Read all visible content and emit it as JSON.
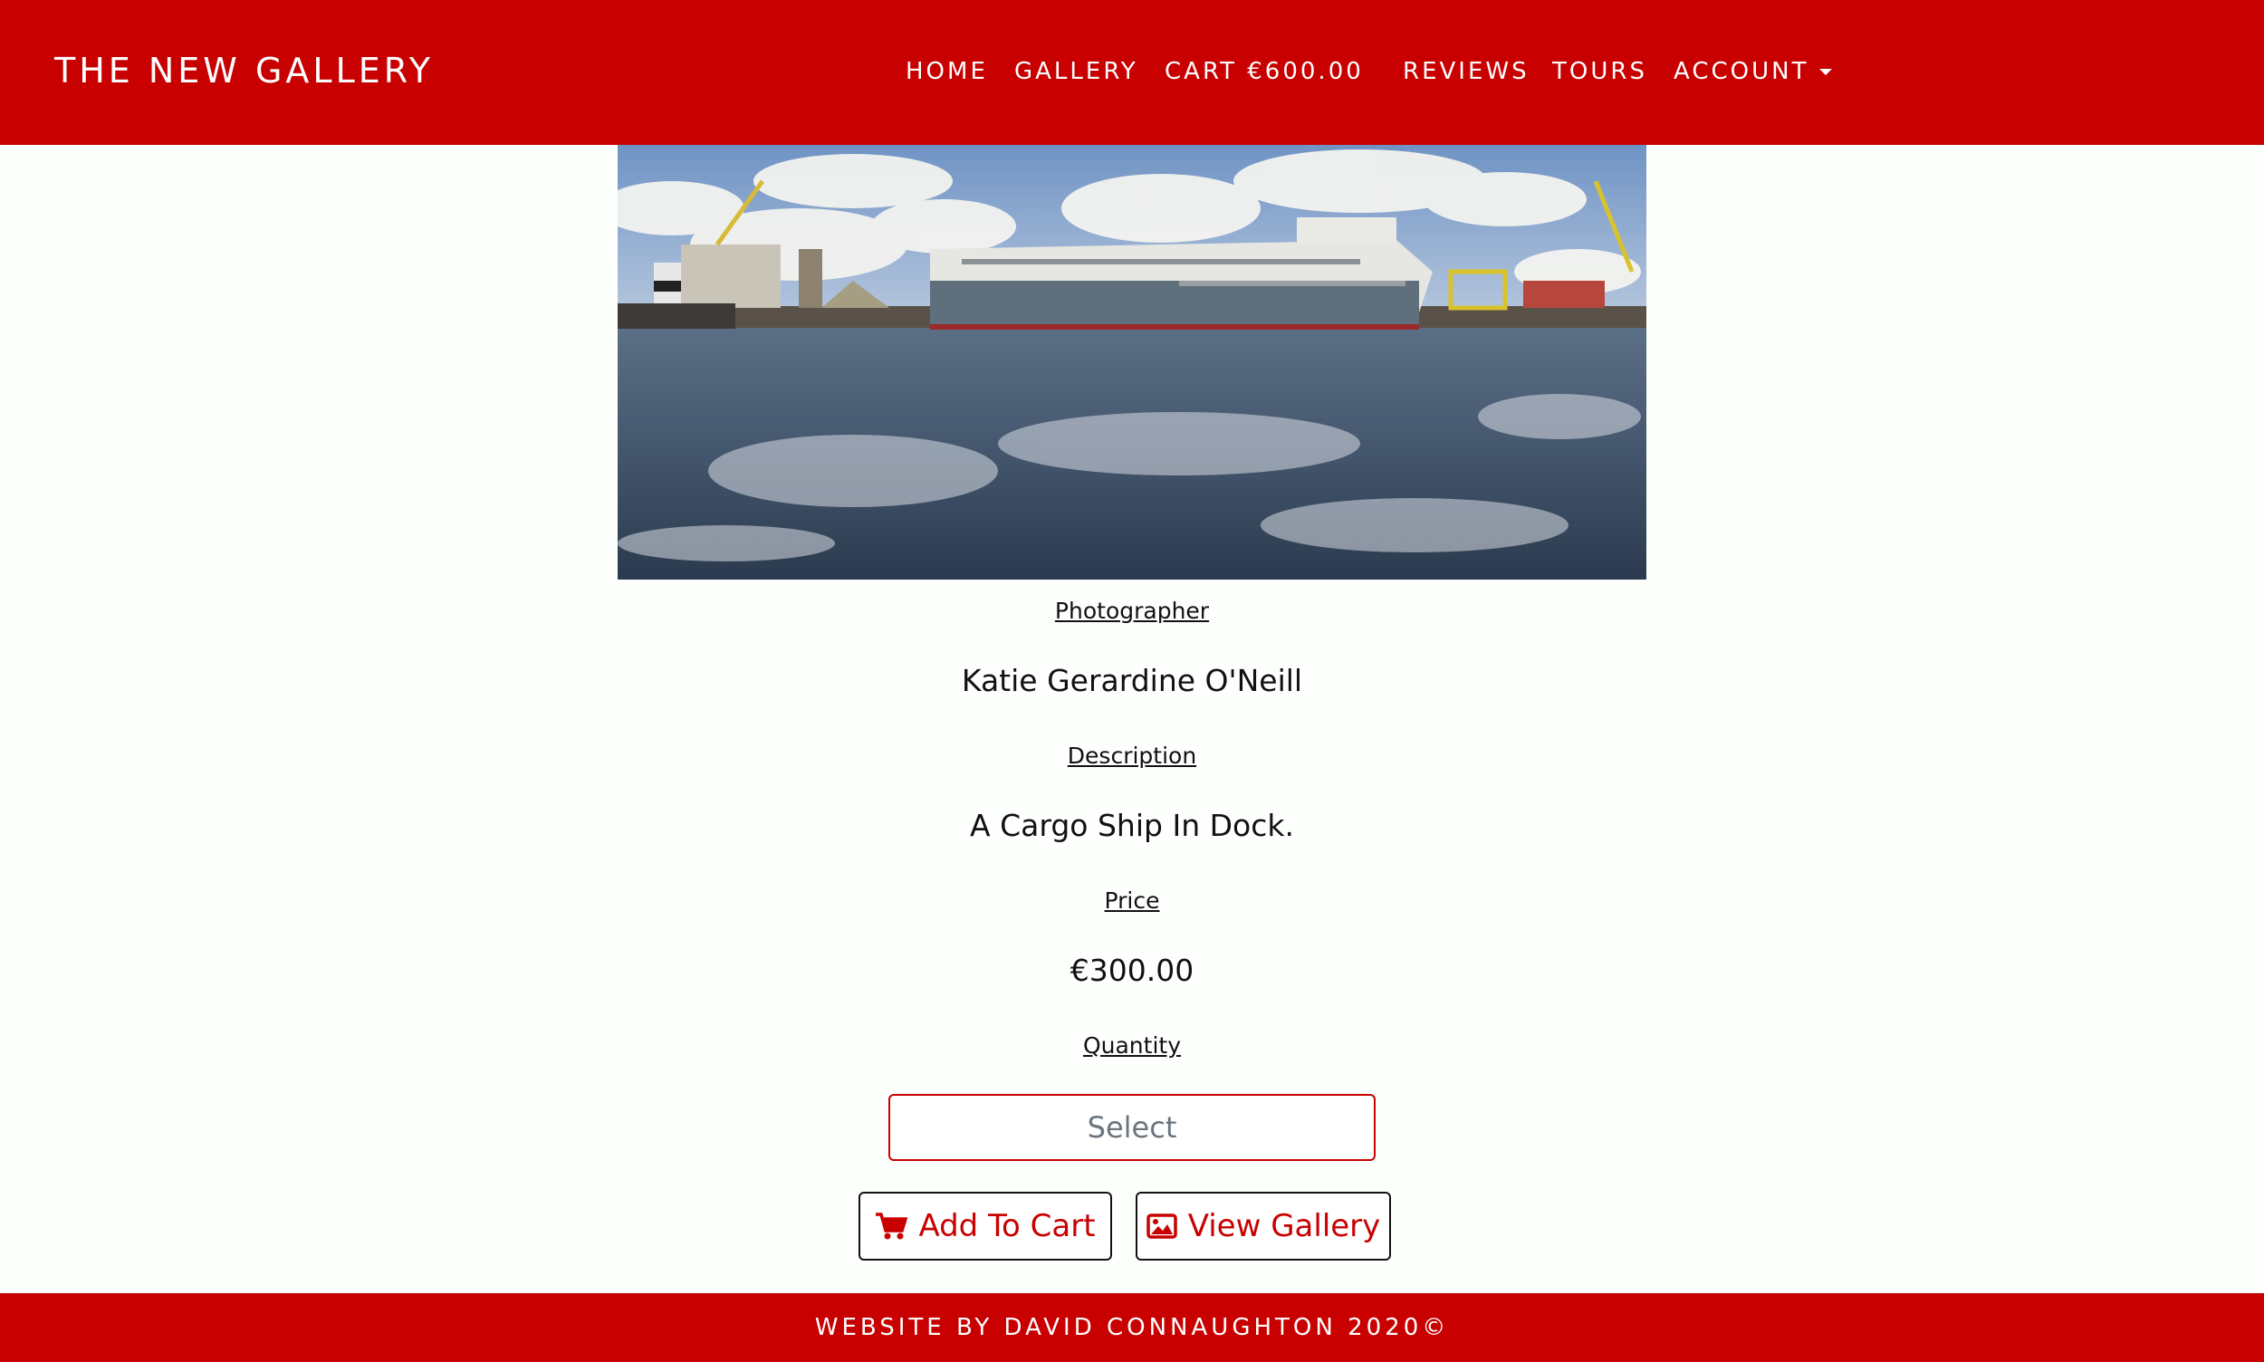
{
  "brand": "THE NEW GALLERY",
  "nav": {
    "home": "HOME",
    "gallery": "GALLERY",
    "cart": "CART €600.00",
    "reviews": "REVIEWS",
    "tours": "TOURS",
    "account": "ACCOUNT"
  },
  "product": {
    "photographer_label": "Photographer",
    "photographer": "Katie Gerardine O'Neill",
    "description_label": "Description",
    "description": "A Cargo Ship In Dock.",
    "price_label": "Price",
    "price": "€300.00",
    "quantity_label": "Quantity",
    "quantity_placeholder": "Select"
  },
  "actions": {
    "add_to_cart": "Add To Cart",
    "view_gallery": "View Gallery"
  },
  "footer": "WEBSITE BY DAVID CONNAUGHTON 2020©",
  "colors": {
    "brand_red": "#c80000",
    "background": "#fcfffc"
  },
  "icons": {
    "cart": "cart-icon",
    "gallery": "image-icon",
    "dropdown": "caret-down-icon"
  }
}
